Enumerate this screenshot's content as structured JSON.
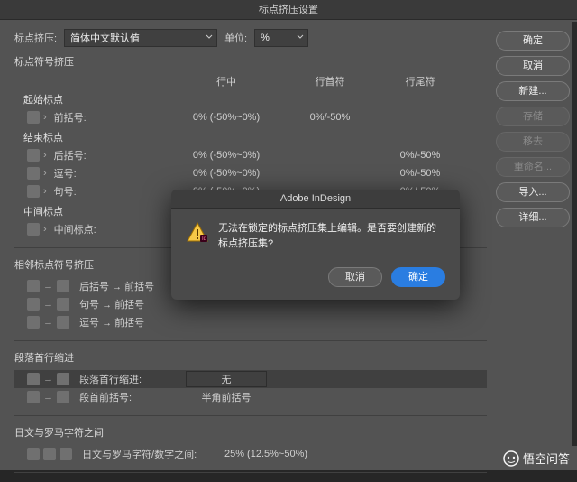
{
  "title": "标点挤压设置",
  "header": {
    "mojikumi_label": "标点挤压:",
    "mojikumi_value": "简体中文默认值",
    "unit_label": "单位:",
    "unit_value": "%"
  },
  "side": {
    "ok": "确定",
    "cancel": "取消",
    "new": "新建...",
    "save": "存储",
    "remove": "移去",
    "rename": "重命名...",
    "import": "导入...",
    "detail": "详细..."
  },
  "sec1": {
    "title": "标点符号挤压",
    "col_a": "行中",
    "col_b": "行首符",
    "col_c": "行尾符",
    "grp1": "起始标点",
    "grp2": "结束标点",
    "grp3": "中间标点",
    "rows": {
      "r1": {
        "label": "前括号:",
        "a": "0% (-50%~0%)",
        "b": "0%/-50%",
        "c": ""
      },
      "r2": {
        "label": "后括号:",
        "a": "0% (-50%~0%)",
        "b": "",
        "c": "0%/-50%"
      },
      "r3": {
        "label": "逗号:",
        "a": "0% (-50%~0%)",
        "b": "",
        "c": "0%/-50%"
      },
      "r4": {
        "label": "句号:",
        "a": "0% (-50%~0%)",
        "b": "",
        "c": "0%/-50%"
      },
      "r5": {
        "label": "中间标点:",
        "a": "",
        "b": "",
        "c": ""
      }
    }
  },
  "sec2": {
    "title": "相邻标点符号挤压",
    "rows": {
      "r1": "后括号 → 前括号",
      "r2": "句号 → 前括号",
      "r3": "逗号 → 前括号"
    }
  },
  "sec3": {
    "title": "段落首行缩进",
    "rows": {
      "r1": {
        "label": "段落首行缩进:",
        "val": "无"
      },
      "r2": {
        "label": "段首前括号:",
        "val": "半角前括号"
      }
    }
  },
  "sec4": {
    "title": "日文与罗马字符之间",
    "rows": {
      "r1": {
        "label": "日文与罗马字符/数字之间:",
        "val": "25% (12.5%~50%)"
      }
    }
  },
  "modal": {
    "title": "Adobe InDesign",
    "message": "无法在锁定的标点挤压集上编辑。是否要创建新的标点挤压集?",
    "cancel": "取消",
    "ok": "确定"
  },
  "watermark": "悟空问答"
}
